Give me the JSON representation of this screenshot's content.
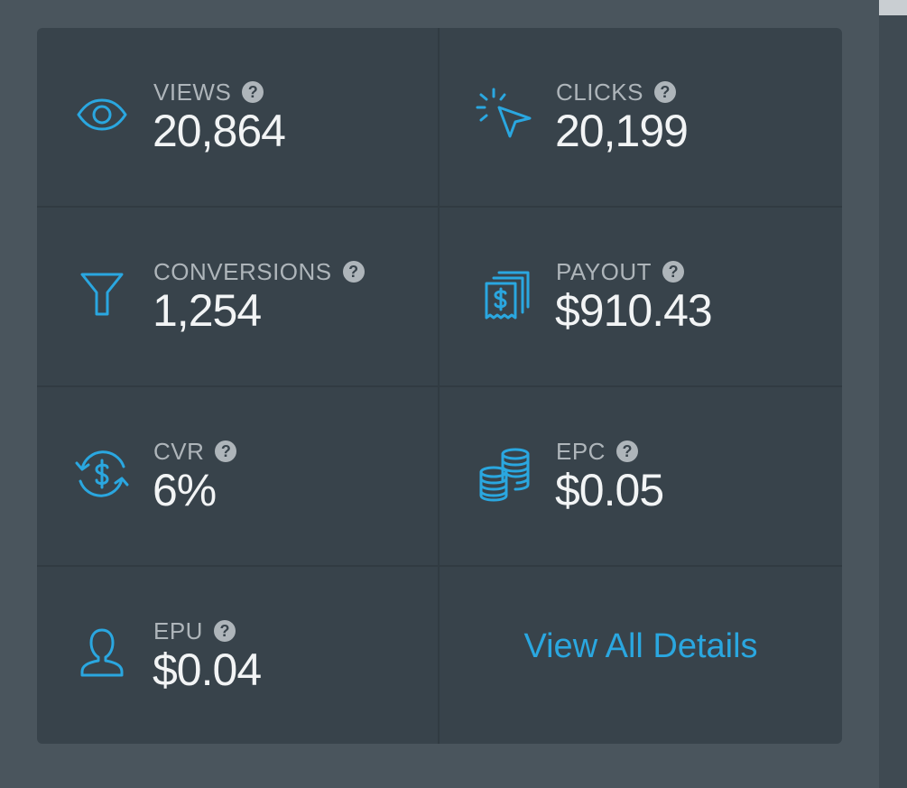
{
  "colors": {
    "accent": "#2aa7e0",
    "card_background": "#38434b",
    "page_background": "#4a555d"
  },
  "stats": [
    {
      "label": "VIEWS",
      "value": "20,864",
      "icon": "eye-icon"
    },
    {
      "label": "CLICKS",
      "value": "20,199",
      "icon": "cursor-click-icon"
    },
    {
      "label": "CONVERSIONS",
      "value": "1,254",
      "icon": "funnel-icon"
    },
    {
      "label": "PAYOUT",
      "value": "$910.43",
      "icon": "receipt-stack-icon"
    },
    {
      "label": "CVR",
      "value": "6%",
      "icon": "dollar-cycle-icon"
    },
    {
      "label": "EPC",
      "value": "$0.05",
      "icon": "coin-stack-icon"
    },
    {
      "label": "EPU",
      "value": "$0.04",
      "icon": "user-icon"
    }
  ],
  "help_glyph": "?",
  "view_all_label": "View All Details"
}
